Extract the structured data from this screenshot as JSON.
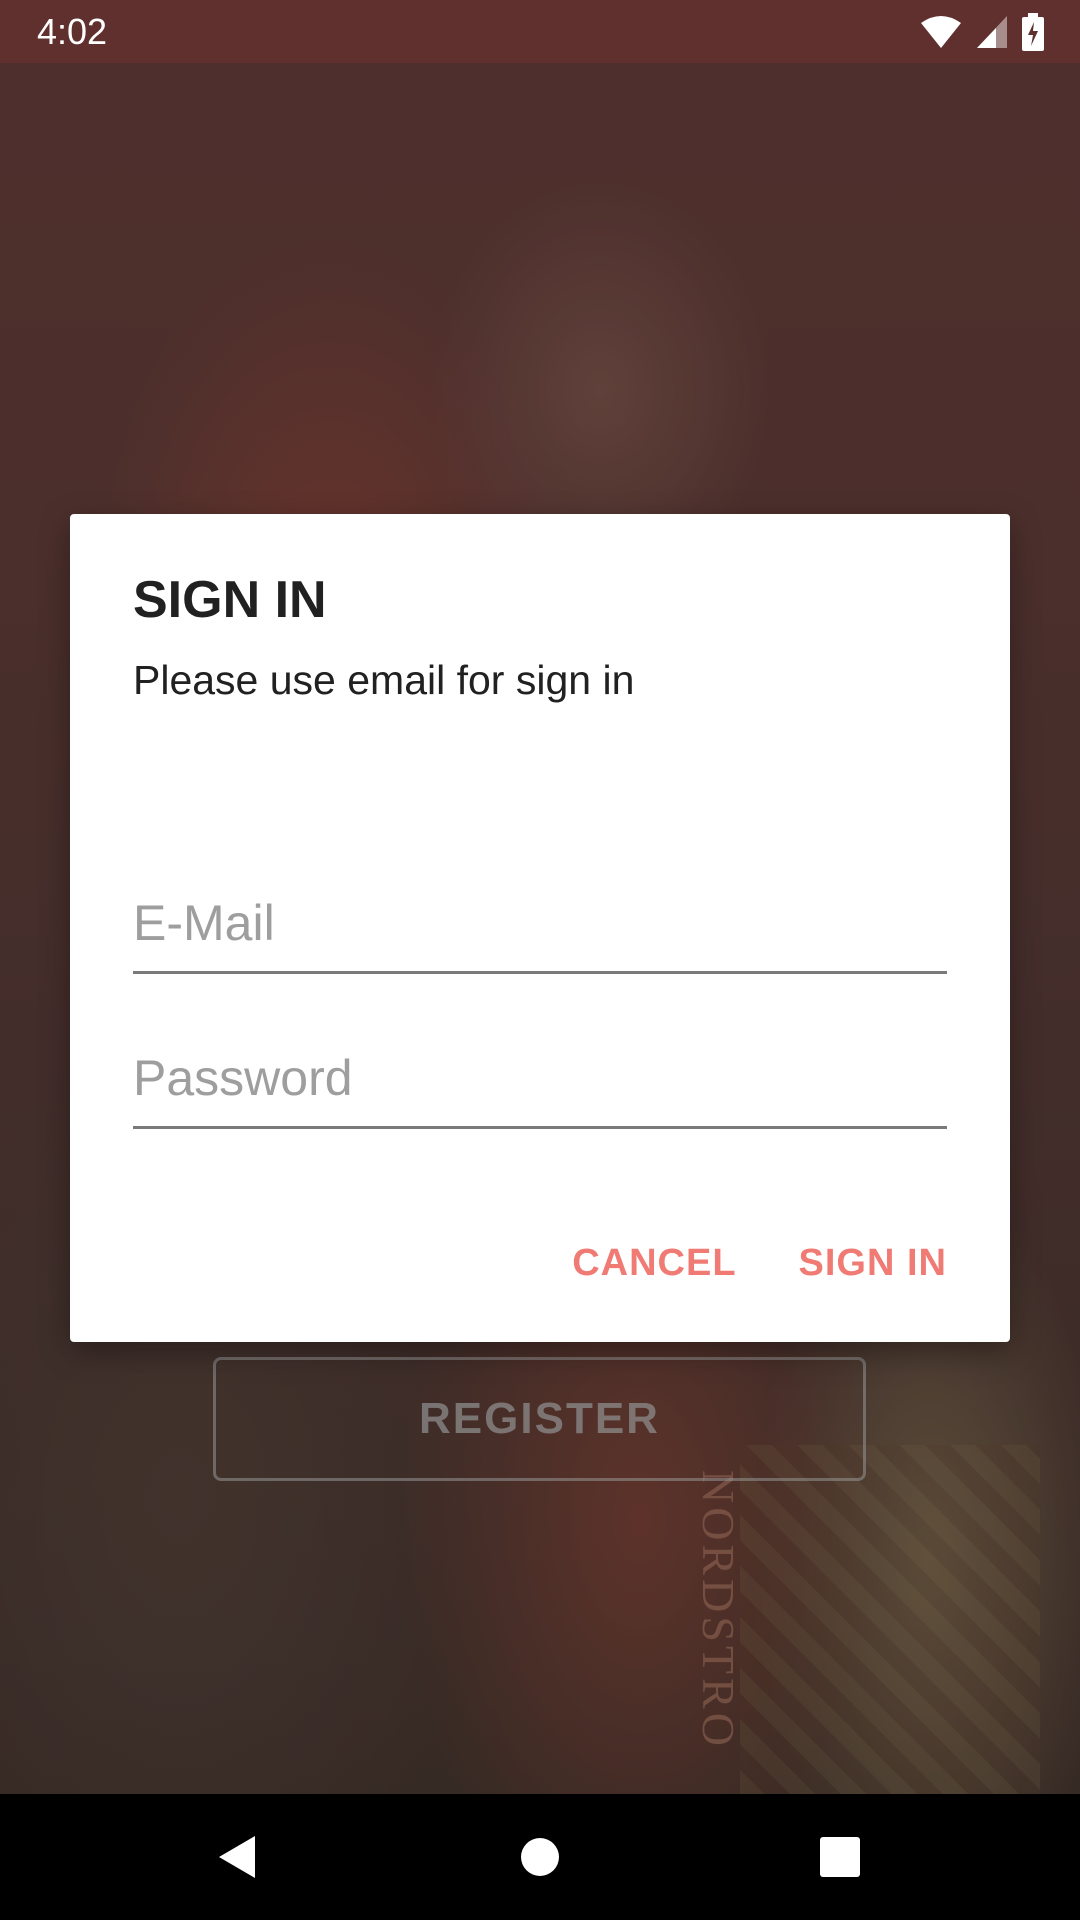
{
  "status_bar": {
    "time": "4:02",
    "icons": [
      "wifi-icon",
      "signal-icon",
      "battery-charging-icon"
    ]
  },
  "background": {
    "bag_text": "NORDSTRO"
  },
  "register": {
    "label": "REGISTER"
  },
  "dialog": {
    "title": "SIGN IN",
    "message": "Please use email for sign in",
    "email": {
      "value": "",
      "placeholder": "E-Mail"
    },
    "password": {
      "value": "",
      "placeholder": "Password"
    },
    "actions": {
      "cancel": "CANCEL",
      "sign_in": "SIGN IN"
    },
    "accent_color": "#f07b74"
  },
  "nav_bar": {
    "buttons": [
      "back-icon",
      "home-icon",
      "recents-icon"
    ]
  }
}
